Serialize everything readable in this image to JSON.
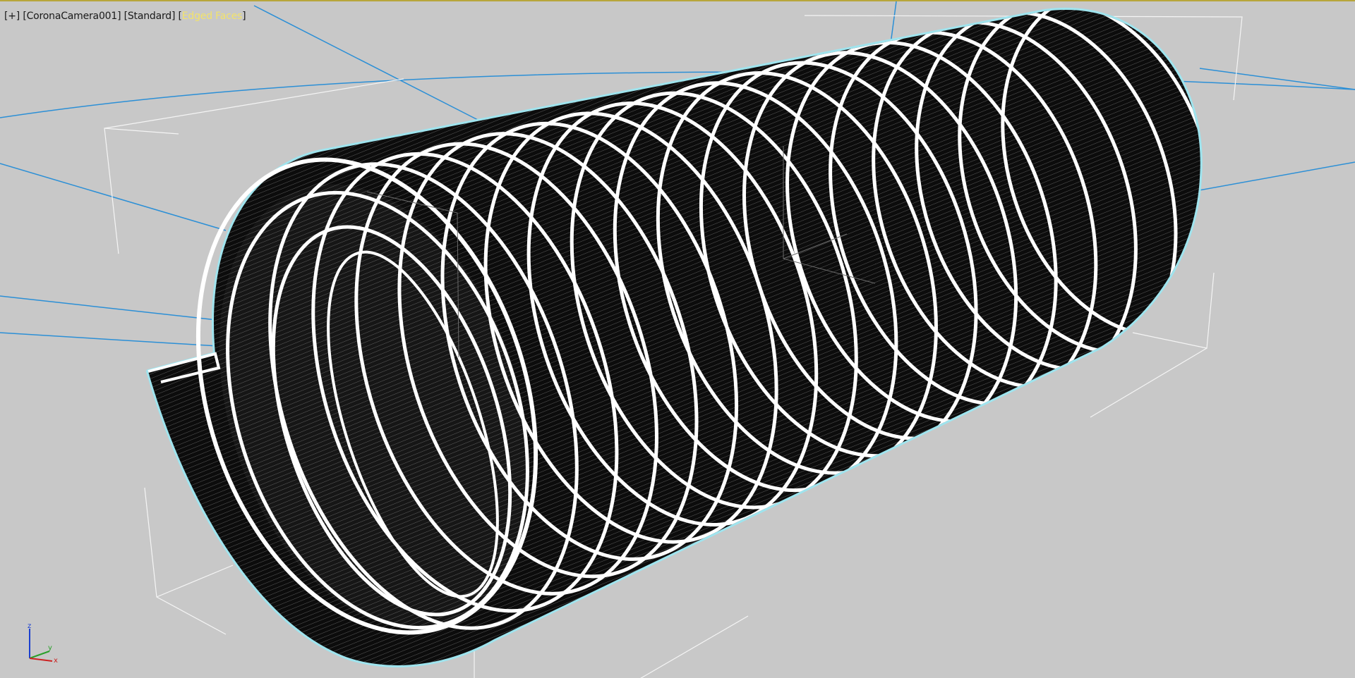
{
  "viewport": {
    "label_plus": "+",
    "label_camera": "CoronaCamera001",
    "label_mode": "Standard",
    "label_shading": "Edged Faces"
  },
  "axis_tripod": {
    "z": "z",
    "y": "y",
    "x": "x"
  },
  "colors": {
    "background": "#c8c8c8",
    "active_border": "#b8a63a",
    "selection_outline": "#9fe4ee",
    "camera_lines": "#2b8fd6",
    "active_label": "#f3e36a"
  },
  "icons": [
    "axis-tripod-icon"
  ]
}
